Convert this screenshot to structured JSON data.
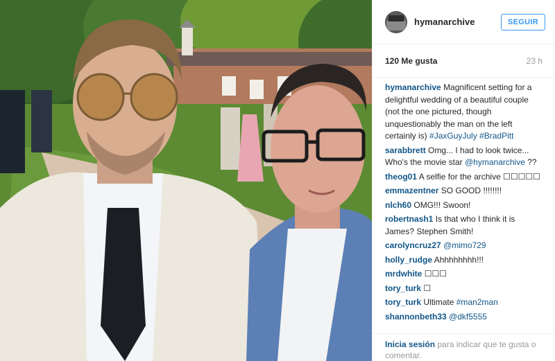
{
  "post": {
    "username": "hymanarchive",
    "follow_label": "SEGUIR",
    "likes": "120 Me gusta",
    "age": "23 h"
  },
  "caption": {
    "user": "hymanarchive",
    "text": "Magnificent setting for a delightful wedding of a beautiful couple (not the one pictured, though unquestionably the man on the left certainly is)",
    "hashtags": "#JaxGuyJuly #BradPitt"
  },
  "comments": [
    {
      "user": "sarabbrett",
      "text": "Omg... I had to look twice... Who's the movie star ",
      "mention": "@hymanarchive",
      "after": " ??"
    },
    {
      "user": "theog01",
      "text": "A selfie for the archive ☐☐☐☐☐",
      "mention": "",
      "after": ""
    },
    {
      "user": "emmazentner",
      "text": "SO GOOD !!!!!!!!",
      "mention": "",
      "after": ""
    },
    {
      "user": "nlch60",
      "text": "OMG!!! Swoon!",
      "mention": "",
      "after": ""
    },
    {
      "user": "robertnash1",
      "text": "Is that who I think it is James? Stephen Smith!",
      "mention": "",
      "after": ""
    },
    {
      "user": "carolyncruz27",
      "text": "",
      "mention": "@mimo729",
      "after": ""
    },
    {
      "user": "holly_rudge",
      "text": "Ahhhhhhhh!!!",
      "mention": "",
      "after": ""
    },
    {
      "user": "mrdwhite",
      "text": "☐☐☐",
      "mention": "",
      "after": ""
    },
    {
      "user": "tory_turk",
      "text": "☐",
      "mention": "",
      "after": ""
    },
    {
      "user": "tory_turk",
      "text": "Ultimate ",
      "mention": "#man2man",
      "after": ""
    },
    {
      "user": "shannonbeth33",
      "text": "",
      "mention": "@dkf5555",
      "after": ""
    }
  ],
  "footer": {
    "login": "Inicia sesión",
    "text": " para indicar que te gusta o comentar."
  },
  "colors": {
    "accent": "#3897f0",
    "username": "#125688",
    "text": "#262626",
    "muted": "#999999"
  },
  "icons": {
    "avatar": "avatar-image",
    "photo": "wedding-selfie-photo"
  }
}
